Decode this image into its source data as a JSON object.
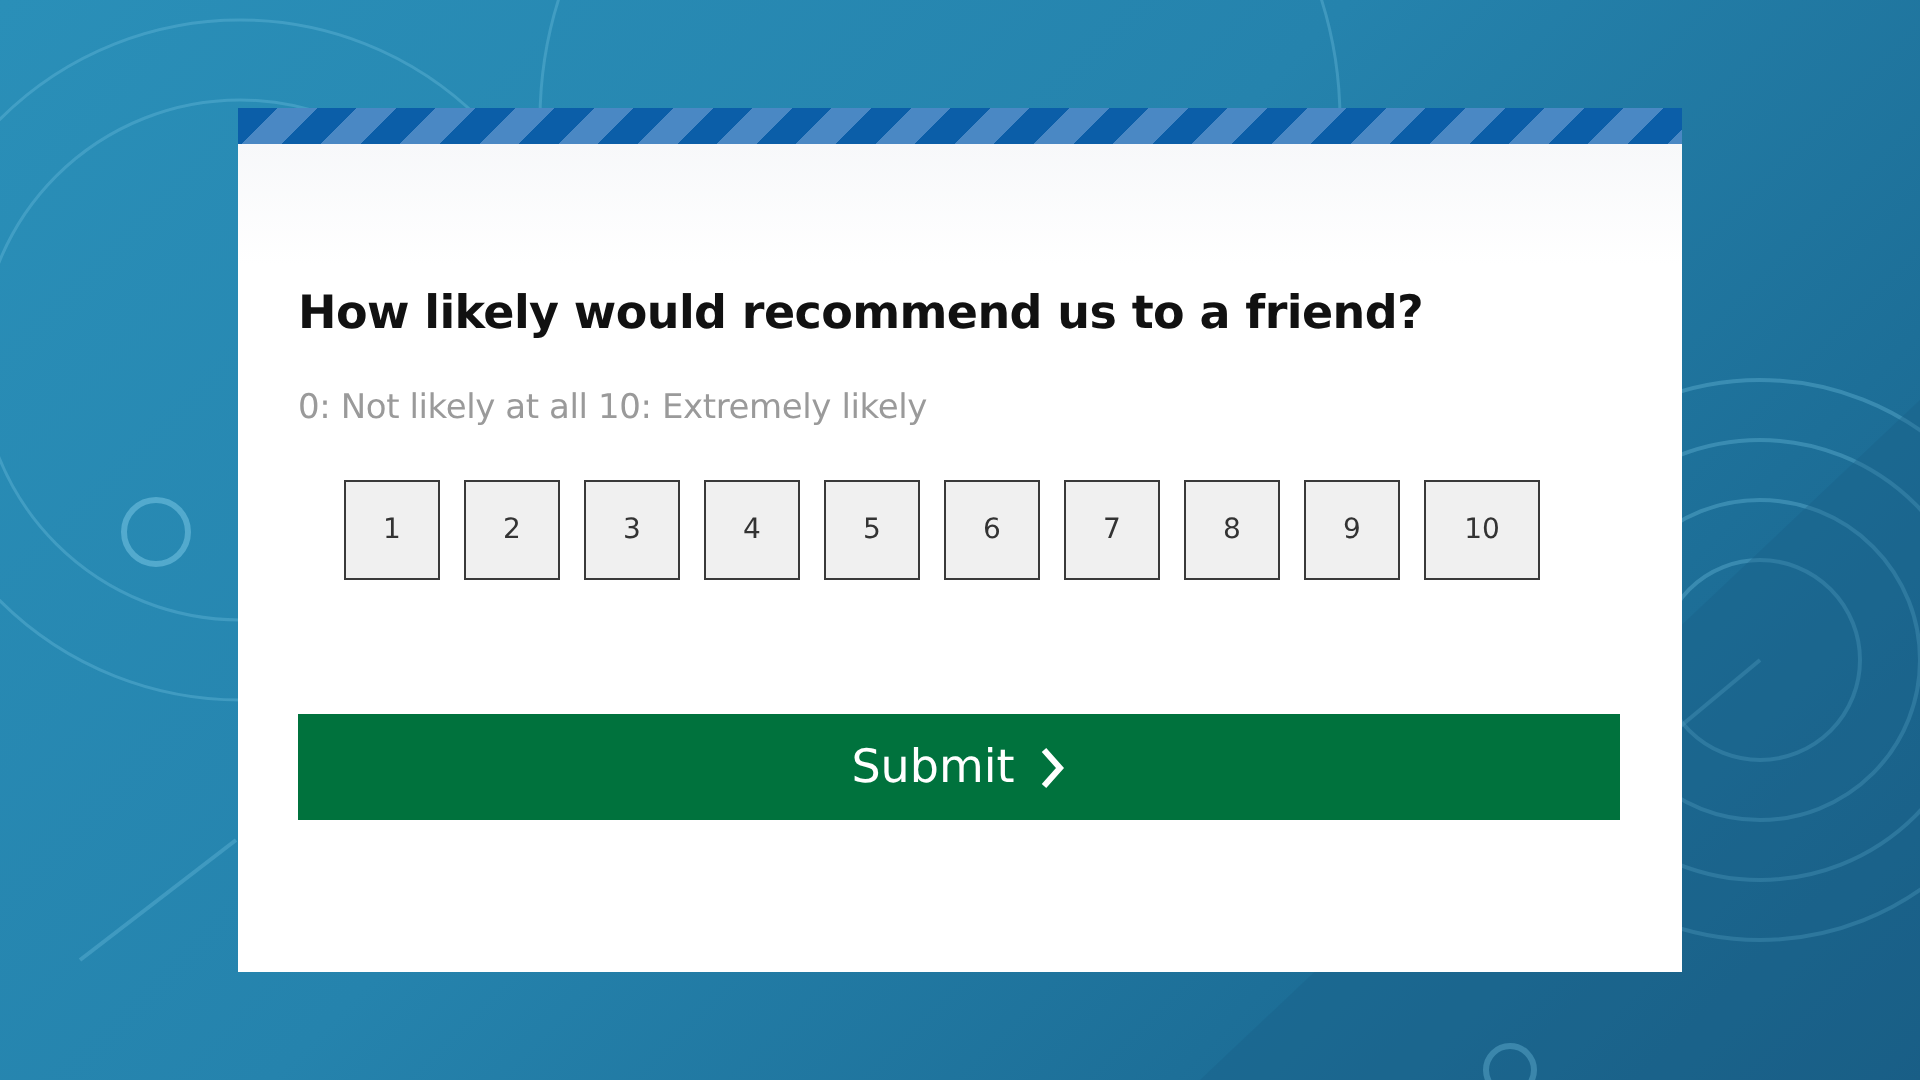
{
  "survey": {
    "question": "How likely would recommend us to a friend?",
    "hint": "0: Not likely at all 10: Extremely likely",
    "scale": [
      {
        "label": "1",
        "selected": false
      },
      {
        "label": "2",
        "selected": false
      },
      {
        "label": "3",
        "selected": false
      },
      {
        "label": "4",
        "selected": false
      },
      {
        "label": "5",
        "selected": false
      },
      {
        "label": "6",
        "selected": false
      },
      {
        "label": "7",
        "selected": false
      },
      {
        "label": "8",
        "selected": false
      },
      {
        "label": "9",
        "selected": false
      },
      {
        "label": "10",
        "selected": false
      }
    ],
    "submit": "Submit"
  }
}
